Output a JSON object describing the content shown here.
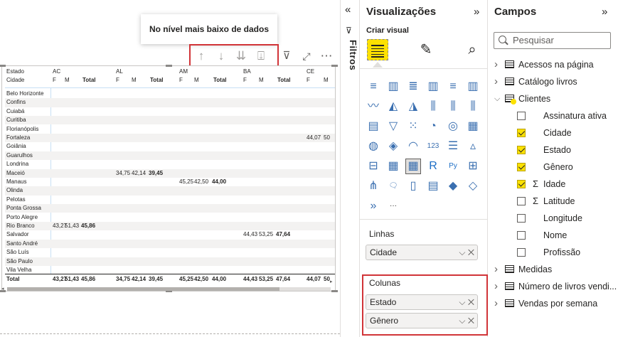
{
  "tooltip": {
    "text": "No nível mais baixo de dados"
  },
  "matrix": {
    "row_header_label": "Estado",
    "col_header_label": "Cidade",
    "states": [
      "AC",
      "AL",
      "AM",
      "BA",
      "CE"
    ],
    "subcols": [
      "F",
      "M",
      "Total"
    ],
    "cities": [
      "Belo Horizonte",
      "Confins",
      "Cuiabá",
      "Curitiba",
      "Florianópolis",
      "Fortaleza",
      "Goiânia",
      "Guarulhos",
      "Londrina",
      "Maceió",
      "Manaus",
      "Olinda",
      "Pelotas",
      "Ponta Grossa",
      "Porto Alegre",
      "Rio Branco",
      "Salvador",
      "Santo André",
      "São Luís",
      "São Paulo",
      "Vila Velha"
    ],
    "values": {
      "Fortaleza": {
        "CE_F": "44,07",
        "CE_M": "50"
      },
      "Maceió": {
        "AL_F": "34,75",
        "AL_M": "42,14",
        "AL_Total": "39,45"
      },
      "Manaus": {
        "AM_F": "45,25",
        "AM_M": "42,50",
        "AM_Total": "44,00"
      },
      "Rio Branco": {
        "AC_F": "43,27",
        "AC_M": "51,43",
        "AC_Total": "45,86"
      },
      "Salvador": {
        "BA_F": "44,43",
        "BA_M": "53,25",
        "BA_Total": "47,64"
      }
    },
    "total_label": "Total",
    "totals": [
      "43,27",
      "51,43",
      "45,86",
      "34,75",
      "42,14",
      "39,45",
      "45,25",
      "42,50",
      "44,00",
      "44,43",
      "53,25",
      "47,64",
      "44,07",
      "50"
    ]
  },
  "filters": {
    "label": "Filtros"
  },
  "visualizations": {
    "title": "Visualizações",
    "subtitle": "Criar visual",
    "linhas_label": "Linhas",
    "linhas_fields": [
      "Cidade"
    ],
    "colunas_label": "Colunas",
    "colunas_fields": [
      "Estado",
      "Gênero"
    ],
    "more": "···"
  },
  "fields": {
    "title": "Campos",
    "search_placeholder": "Pesquisar",
    "tables": [
      {
        "name": "Acessos na página",
        "expanded": false
      },
      {
        "name": "Catálogo livros",
        "expanded": false
      },
      {
        "name": "Clientes",
        "expanded": true
      },
      {
        "name": "Medidas",
        "expanded": false
      },
      {
        "name": "Número de livros vendi...",
        "expanded": false
      },
      {
        "name": "Vendas por semana",
        "expanded": false
      }
    ],
    "clientes_fields": [
      {
        "name": "Assinatura ativa",
        "checked": false,
        "sigma": false
      },
      {
        "name": "Cidade",
        "checked": true,
        "sigma": false
      },
      {
        "name": "Estado",
        "checked": true,
        "sigma": false
      },
      {
        "name": "Gênero",
        "checked": true,
        "sigma": false
      },
      {
        "name": "Idade",
        "checked": true,
        "sigma": true
      },
      {
        "name": "Latitude",
        "checked": false,
        "sigma": true
      },
      {
        "name": "Longitude",
        "checked": false,
        "sigma": false
      },
      {
        "name": "Nome",
        "checked": false,
        "sigma": false
      },
      {
        "name": "Profissão",
        "checked": false,
        "sigma": false
      }
    ]
  },
  "colors": {
    "accent": "#fce100",
    "highlight": "#d13438",
    "selection": "#118dff"
  }
}
